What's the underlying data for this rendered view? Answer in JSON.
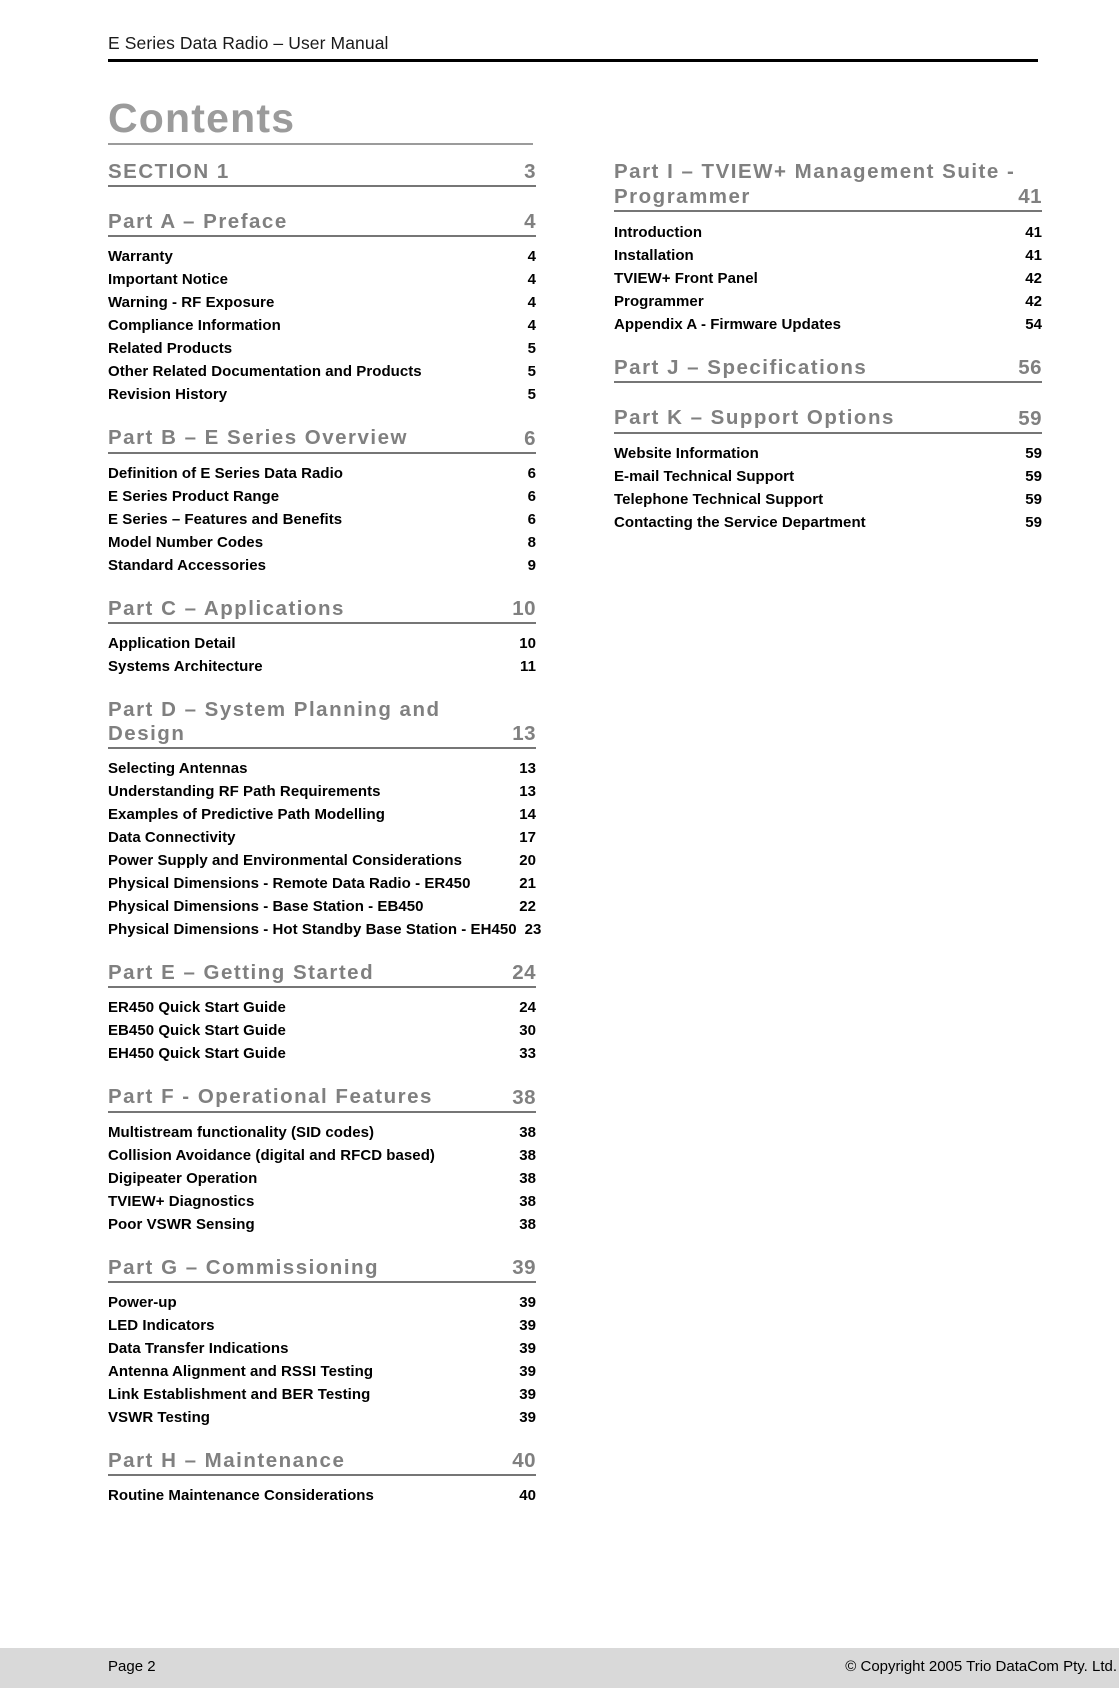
{
  "header": {
    "title": "E Series Data Radio – User Manual"
  },
  "page_title": "Contents",
  "colors": {
    "heading_gray": "#808080",
    "rule_gray": "#767676",
    "header_rule_black": "#000000",
    "footer_bar": "#d9d9d9",
    "entry_black": "#000000"
  },
  "columns": {
    "left": [
      {
        "type": "part",
        "title": "SECTION 1",
        "page": "3"
      },
      {
        "type": "part",
        "title": "Part A – Preface",
        "page": "4"
      },
      {
        "type": "entry",
        "title": "Warranty",
        "page": "4"
      },
      {
        "type": "entry",
        "title": "Important Notice",
        "page": "4"
      },
      {
        "type": "entry",
        "title": "Warning - RF Exposure",
        "page": "4"
      },
      {
        "type": "entry",
        "title": "Compliance Information",
        "page": "4"
      },
      {
        "type": "entry",
        "title": "Related Products",
        "page": "5"
      },
      {
        "type": "entry",
        "title": "Other Related Documentation and Products",
        "page": "5"
      },
      {
        "type": "entry",
        "title": "Revision History",
        "page": "5"
      },
      {
        "type": "part",
        "title": "Part B – E Series Overview",
        "page": "6"
      },
      {
        "type": "entry",
        "title": "Definition of E Series Data Radio",
        "page": "6"
      },
      {
        "type": "entry",
        "title": "E Series Product Range",
        "page": "6"
      },
      {
        "type": "entry",
        "title": "E Series – Features and Benefits",
        "page": "6"
      },
      {
        "type": "entry",
        "title": "Model Number Codes",
        "page": "8"
      },
      {
        "type": "entry",
        "title": "Standard Accessories",
        "page": "9"
      },
      {
        "type": "part",
        "title": "Part C – Applications",
        "page": "10"
      },
      {
        "type": "entry",
        "title": "Application Detail",
        "page": "10"
      },
      {
        "type": "entry",
        "title": "Systems Architecture",
        "page": "11"
      },
      {
        "type": "part",
        "title": "Part D – System Planning and Design",
        "page": "13"
      },
      {
        "type": "entry",
        "title": "Selecting Antennas",
        "page": "13"
      },
      {
        "type": "entry",
        "title": "Understanding RF Path Requirements",
        "page": "13"
      },
      {
        "type": "entry",
        "title": "Examples of Predictive Path Modelling",
        "page": "14"
      },
      {
        "type": "entry",
        "title": "Data Connectivity",
        "page": "17"
      },
      {
        "type": "entry",
        "title": "Power Supply and Environmental Considerations",
        "page": "20"
      },
      {
        "type": "entry",
        "title": "Physical Dimensions - Remote Data Radio - ER450",
        "page": "21"
      },
      {
        "type": "entry",
        "title": "Physical Dimensions - Base Station - EB450",
        "page": "22"
      },
      {
        "type": "entry",
        "title": "Physical Dimensions - Hot Standby Base Station - EH450",
        "page": "23"
      },
      {
        "type": "part",
        "title": "Part E – Getting Started",
        "page": "24"
      },
      {
        "type": "entry",
        "title": "ER450 Quick Start Guide",
        "page": "24"
      },
      {
        "type": "entry",
        "title": "EB450 Quick Start Guide",
        "page": "30"
      },
      {
        "type": "entry",
        "title": "EH450 Quick Start Guide",
        "page": "33"
      },
      {
        "type": "part",
        "title": "Part F - Operational Features",
        "page": "38"
      },
      {
        "type": "entry",
        "title": "Multistream functionality (SID codes)",
        "page": "38"
      },
      {
        "type": "entry",
        "title": "Collision Avoidance (digital and RFCD based)",
        "page": "38"
      },
      {
        "type": "entry",
        "title": "Digipeater Operation",
        "page": "38"
      },
      {
        "type": "entry",
        "title": "TVIEW+ Diagnostics",
        "page": "38"
      },
      {
        "type": "entry",
        "title": "Poor VSWR Sensing",
        "page": "38"
      },
      {
        "type": "part",
        "title": "Part G – Commissioning",
        "page": "39"
      },
      {
        "type": "entry",
        "title": "Power-up",
        "page": "39"
      },
      {
        "type": "entry",
        "title": "LED Indicators",
        "page": "39"
      },
      {
        "type": "entry",
        "title": "Data Transfer Indications",
        "page": "39"
      },
      {
        "type": "entry",
        "title": "Antenna Alignment and RSSI Testing",
        "page": "39"
      },
      {
        "type": "entry",
        "title": "Link Establishment and BER Testing",
        "page": "39"
      },
      {
        "type": "entry",
        "title": "VSWR Testing",
        "page": "39"
      },
      {
        "type": "part",
        "title": "Part H – Maintenance",
        "page": "40"
      },
      {
        "type": "entry",
        "title": "Routine Maintenance Considerations",
        "page": "40"
      }
    ],
    "right": [
      {
        "type": "part-wrap",
        "title_line1": "Part I – TVIEW+ Management Suite -",
        "title_line2": "Programmer",
        "page": "41"
      },
      {
        "type": "entry",
        "title": "Introduction",
        "page": "41"
      },
      {
        "type": "entry",
        "title": "Installation",
        "page": "41"
      },
      {
        "type": "entry",
        "title": "TVIEW+ Front Panel",
        "page": "42"
      },
      {
        "type": "entry",
        "title": "Programmer",
        "page": "42"
      },
      {
        "type": "entry",
        "title": "Appendix A - Firmware Updates",
        "page": "54"
      },
      {
        "type": "part",
        "title": "Part J – Specifications",
        "page": "56"
      },
      {
        "type": "part",
        "title": "Part K – Support Options",
        "page": "59"
      },
      {
        "type": "entry",
        "title": "Website Information",
        "page": "59"
      },
      {
        "type": "entry",
        "title": "E-mail Technical Support",
        "page": "59"
      },
      {
        "type": "entry",
        "title": "Telephone Technical Support",
        "page": "59"
      },
      {
        "type": "entry",
        "title": "Contacting the Service Department",
        "page": "59"
      }
    ]
  },
  "footer": {
    "left": "Page 2",
    "right": "© Copyright 2005 Trio DataCom Pty. Ltd."
  }
}
